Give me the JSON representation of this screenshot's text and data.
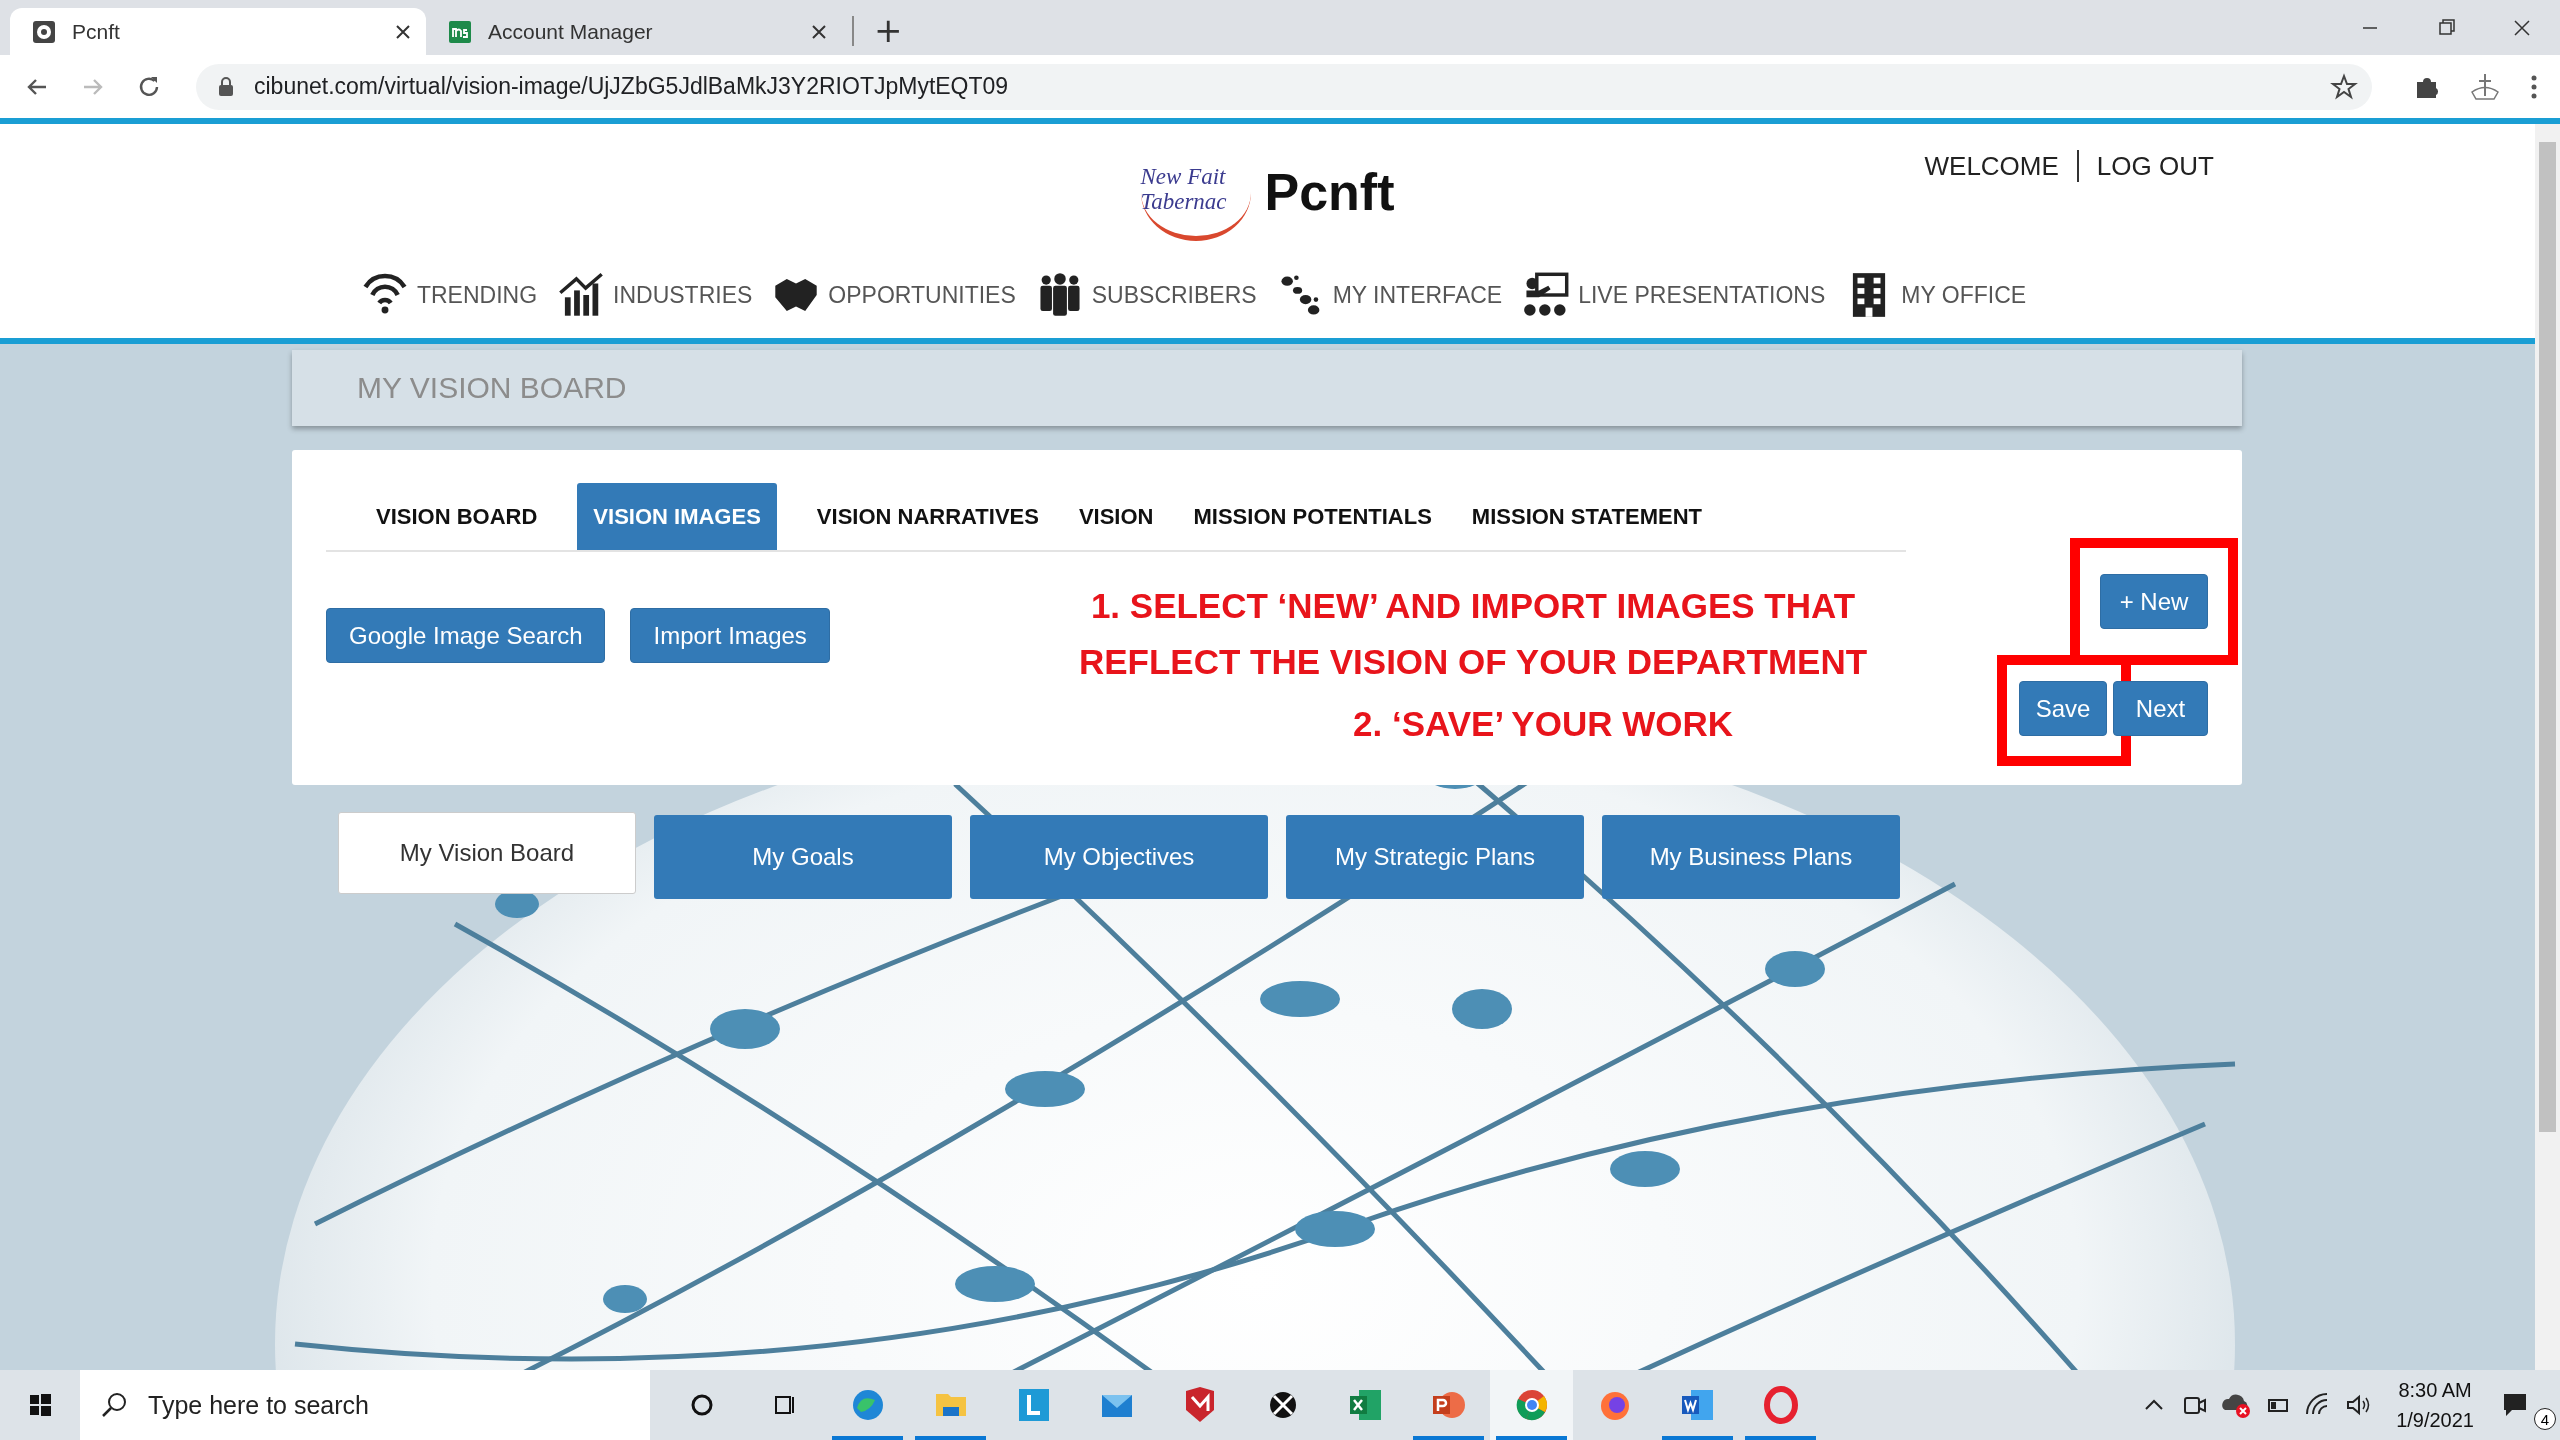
{
  "browser": {
    "tabs": [
      {
        "title": "Pcnft",
        "selected": true
      },
      {
        "title": "Account Manager",
        "selected": false
      }
    ],
    "new_tab": "+",
    "nav": {
      "forward_disabled": true
    },
    "url": "cibunet.com/virtual/vision-image/UjJZbG5JdlBaMkJ3Y2RIOTJpMytEQT09"
  },
  "site": {
    "logo_lines": [
      "New Fait",
      "Tabernac"
    ],
    "brand": "Pcnft",
    "user_links": [
      "WELCOME",
      "LOG OUT"
    ],
    "nav": [
      {
        "label": "TRENDING"
      },
      {
        "label": "INDUSTRIES"
      },
      {
        "label": "OPPORTUNITIES"
      },
      {
        "label": "SUBSCRIBERS"
      },
      {
        "label": "MY INTERFACE"
      },
      {
        "label": "LIVE PRESENTATIONS"
      },
      {
        "label": "MY OFFICE"
      }
    ]
  },
  "page_title": "MY VISION BOARD",
  "section_tabs": [
    {
      "label": "VISION BOARD",
      "selected": false
    },
    {
      "label": "VISION IMAGES",
      "selected": true
    },
    {
      "label": "VISION NARRATIVES",
      "selected": false
    },
    {
      "label": "VISION",
      "selected": false
    },
    {
      "label": "MISSION POTENTIALS",
      "selected": false
    },
    {
      "label": "MISSION STATEMENT",
      "selected": false
    }
  ],
  "tools": [
    "Google Image Search",
    "Import Images"
  ],
  "instructions": [
    "1. SELECT ‘NEW’ AND IMPORT IMAGES THAT REFLECT THE VISION OF YOUR DEPARTMENT",
    "2. ‘SAVE’ YOUR WORK"
  ],
  "actions": [
    {
      "label": "+ New",
      "kind": "new",
      "highlighted": true
    },
    {
      "label": "Save",
      "kind": "save",
      "highlighted": true
    },
    {
      "label": "Next",
      "kind": "next",
      "highlighted": false
    }
  ],
  "board_buttons": [
    {
      "label": "My Vision Board",
      "selected": true
    },
    {
      "label": "My Goals",
      "selected": false
    },
    {
      "label": "My Objectives",
      "selected": false
    },
    {
      "label": "My Strategic Plans",
      "selected": false
    },
    {
      "label": "My Business Plans",
      "selected": false
    }
  ],
  "taskbar": {
    "search_placeholder": "Type here to search",
    "apps": [
      {
        "running": false,
        "active": false
      },
      {
        "running": false,
        "active": false
      },
      {
        "running": true,
        "active": false
      },
      {
        "running": true,
        "active": false
      },
      {
        "running": false,
        "active": false
      },
      {
        "running": false,
        "active": false
      },
      {
        "running": false,
        "active": false
      },
      {
        "running": false,
        "active": false
      },
      {
        "running": false,
        "active": false
      },
      {
        "running": true,
        "active": false
      },
      {
        "running": true,
        "active": true
      },
      {
        "running": false,
        "active": false
      },
      {
        "running": true,
        "active": false
      },
      {
        "running": true,
        "active": false
      }
    ],
    "time": "8:30 AM",
    "date": "1/9/2021",
    "notifications": "4"
  }
}
